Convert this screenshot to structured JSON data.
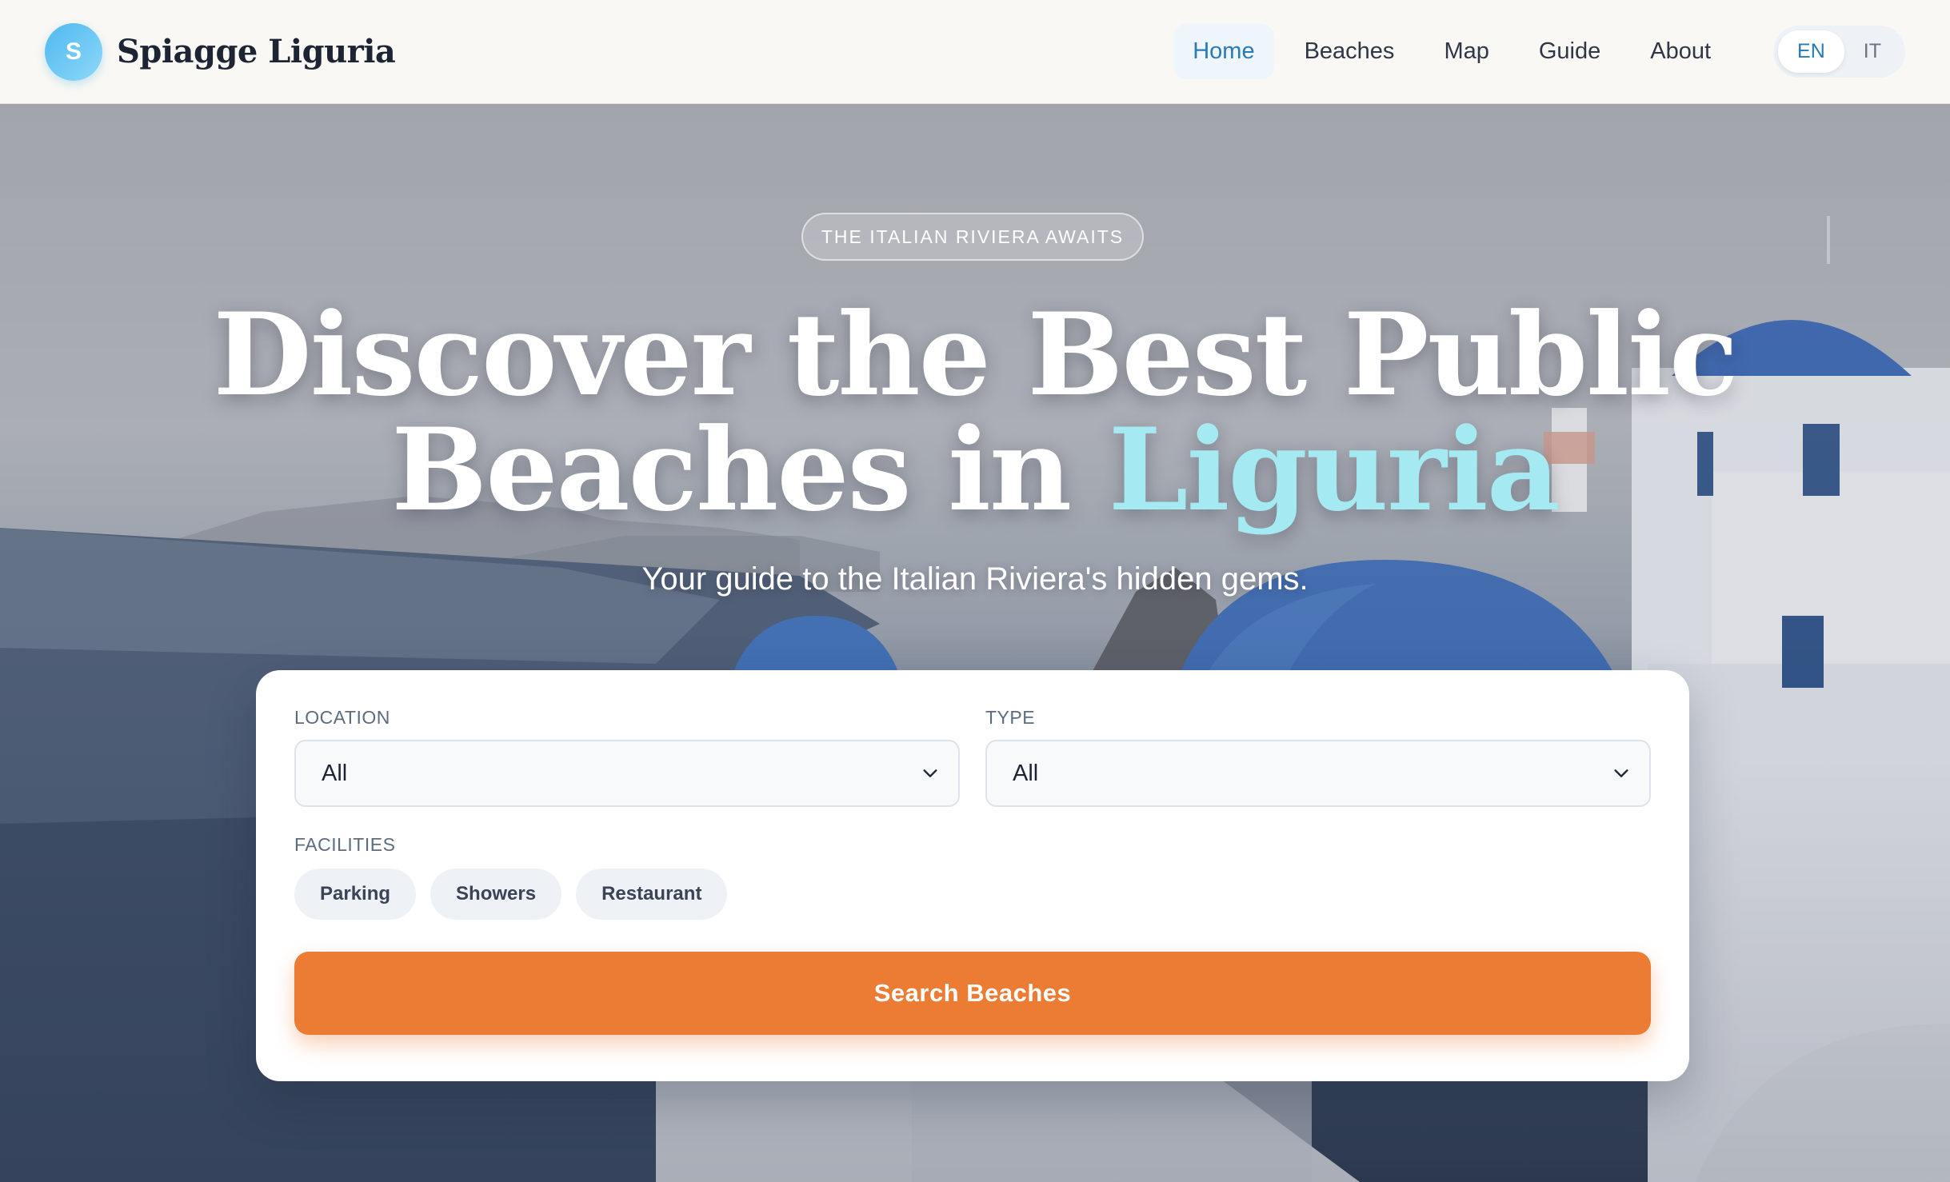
{
  "header": {
    "logo_letter": "S",
    "brand": "Spiagge Liguria",
    "nav": [
      {
        "label": "Home",
        "active": true
      },
      {
        "label": "Beaches",
        "active": false
      },
      {
        "label": "Map",
        "active": false
      },
      {
        "label": "Guide",
        "active": false
      },
      {
        "label": "About",
        "active": false
      }
    ],
    "languages": [
      {
        "label": "EN",
        "active": true
      },
      {
        "label": "IT",
        "active": false
      }
    ]
  },
  "hero": {
    "kicker": "THE ITALIAN RIVIERA AWAITS",
    "title_line1": "Discover the Best Public",
    "title_line2_prefix": "Beaches in ",
    "title_line2_accent": "Liguria",
    "subtitle": "Your guide to the Italian Riviera's hidden gems."
  },
  "search": {
    "location_label": "LOCATION",
    "location_value": "All",
    "type_label": "TYPE",
    "type_value": "All",
    "facilities_label": "FACILITIES",
    "facilities": [
      "Parking",
      "Showers",
      "Restaurant"
    ],
    "submit_label": "Search Beaches"
  },
  "colors": {
    "accent_orange": "#ec7c34",
    "accent_blue": "#2a7ab8",
    "title_accent": "#a5eaf2"
  },
  "icons": {
    "select_arrow": "chevron-down-icon"
  }
}
